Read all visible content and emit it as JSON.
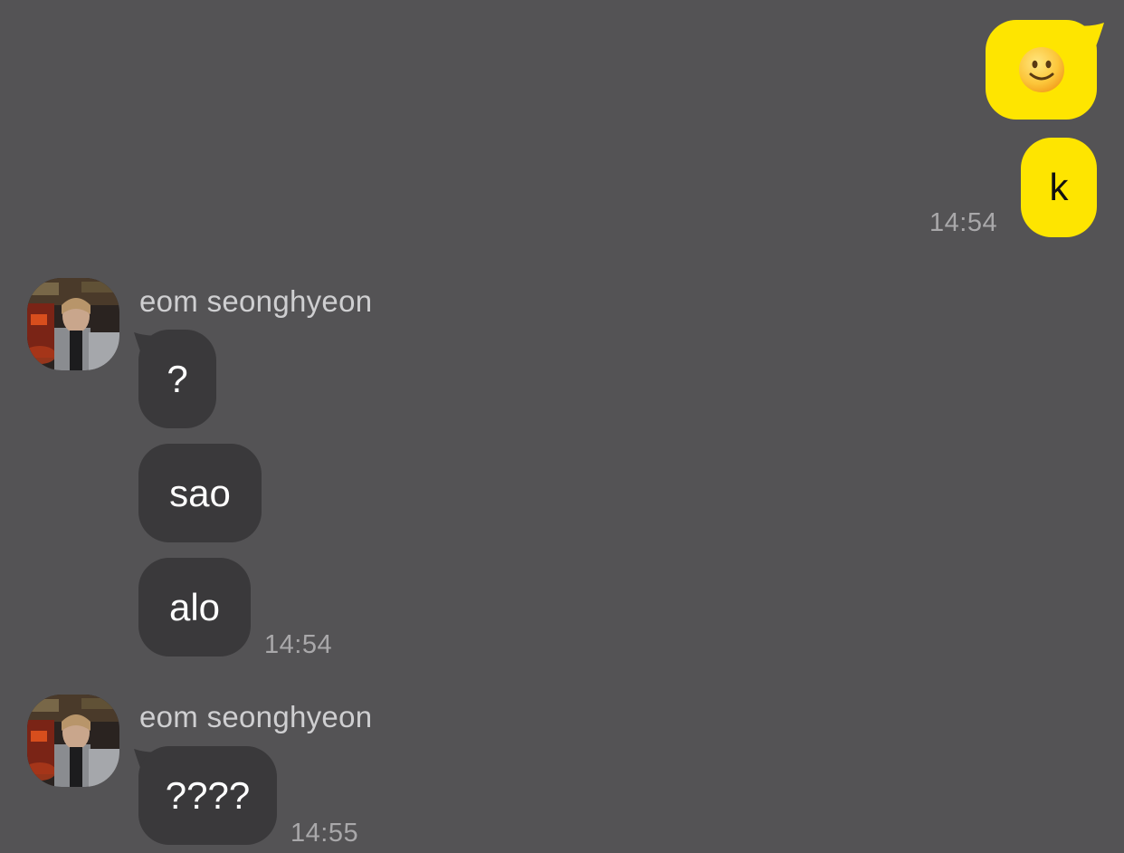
{
  "conversation": {
    "outgoing": {
      "message_1_emoji": "smiling-face-emoji",
      "message_2_text": "k",
      "timestamp": "14:54"
    },
    "incoming_group_1": {
      "sender_name": "eom seonghyeon",
      "messages": [
        "?",
        "sao",
        "alo"
      ],
      "timestamp": "14:54"
    },
    "incoming_group_2": {
      "sender_name": "eom seonghyeon",
      "messages": [
        "????"
      ],
      "timestamp": "14:55"
    }
  },
  "colors": {
    "background": "#545355",
    "outgoing_bubble": "#FEE500",
    "incoming_bubble": "#3A393B",
    "timestamp_text": "#A9A8AA",
    "sender_text": "#CFCFD1"
  },
  "icons": {
    "avatar": "profile-photo-avatar",
    "emoji": "slightly-smiling-face"
  }
}
